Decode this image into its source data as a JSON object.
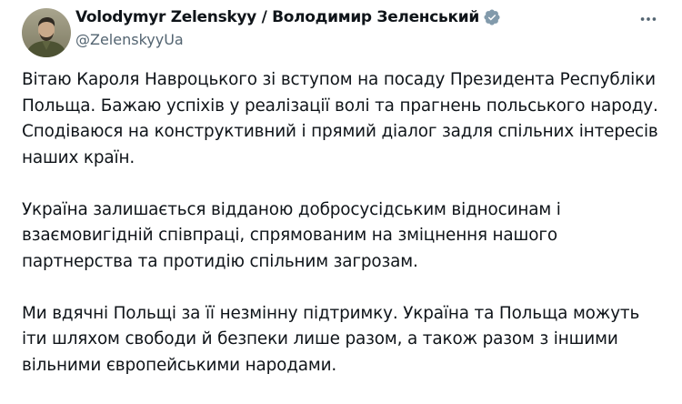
{
  "author": {
    "display_name": "Volodymyr Zelenskyy / Володимир Зеленський",
    "handle": "@ZelenskyyUa",
    "verified": true,
    "verified_color": "#1d9bf0",
    "avatar_icon": "profile-photo"
  },
  "more_icon": "more-horizontal-icon",
  "paragraphs": [
    "Вітаю Кароля Навроцького зі вступом на посаду Президента Республіки Польща. Бажаю успіхів у реалізації волі та прагнень польського народу. Сподіваюся на конструктивний і прямий діалог задля спільних інтересів наших країн.",
    "Україна залишається відданою добросусідським відносинам і взаємовигідній співпраці, спрямованим на зміцнення нашого партнерства та протидію спільним загрозам.",
    "Ми вдячні Польщі за її незмінну підтримку. Україна та Польща можуть іти шляхом свободи й безпеки лише разом, а також разом з іншими вільними європейськими народами."
  ],
  "colors": {
    "text": "#0f1419",
    "secondary_text": "#536471",
    "background": "#ffffff"
  }
}
